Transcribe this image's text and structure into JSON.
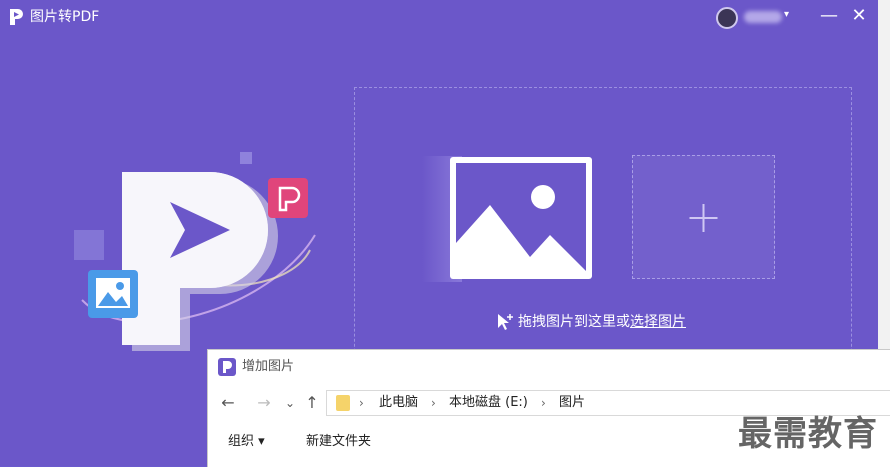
{
  "app": {
    "title": "图片转PDF",
    "minimize_glyph": "—",
    "close_glyph": "✕",
    "user_caret": "▾"
  },
  "dropzone": {
    "hint_prefix": "拖拽图片到这里或",
    "hint_link": "选择图片",
    "add_icon": "plus-icon"
  },
  "dialog": {
    "title": "增加图片",
    "nav": {
      "back": "←",
      "forward": "→",
      "recent": "⌄",
      "up": "↑"
    },
    "breadcrumb": [
      "此电脑",
      "本地磁盘 (E:)",
      "图片"
    ],
    "breadcrumb_sep": "›",
    "toolbar": {
      "organize": "组织 ▾",
      "new_folder": "新建文件夹"
    }
  },
  "watermark": "最需教育",
  "colors": {
    "background": "#6b57c9",
    "accent": "#e0457b",
    "card": "#ffffff"
  }
}
